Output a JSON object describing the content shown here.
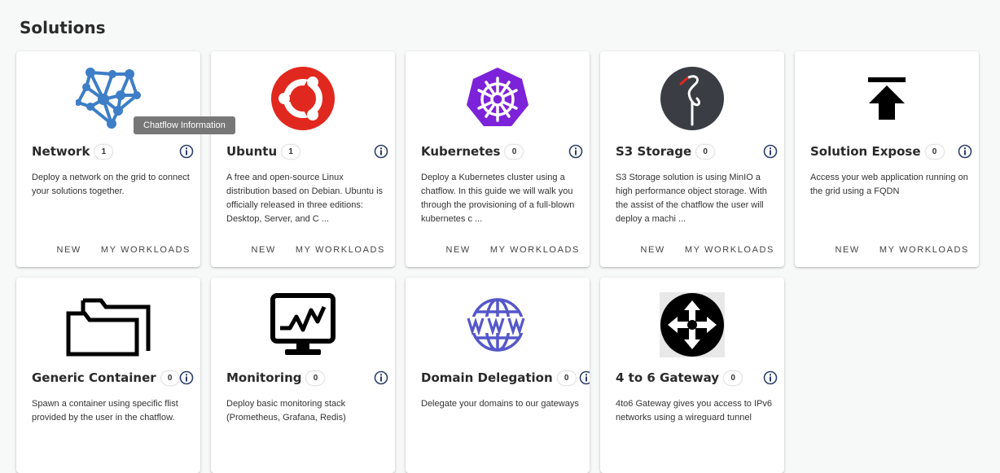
{
  "page": {
    "title": "Solutions"
  },
  "tooltip": {
    "text": "Chatflow Information"
  },
  "actions": {
    "new_label": "NEW",
    "workloads_label": "MY WORKLOADS"
  },
  "colors": {
    "info_icon": "#2c3e6b",
    "ubuntu": "#e1281e",
    "kubernetes": "#7c22d8",
    "s3": "#3a3d44",
    "network": "#3d7ec6",
    "www": "#5557c9"
  },
  "solutions": [
    {
      "name": "Network",
      "count": "1",
      "icon": "network-graph-icon",
      "description": "Deploy a network on the grid to connect your solutions together."
    },
    {
      "name": "Ubuntu",
      "count": "1",
      "icon": "ubuntu-logo-icon",
      "description": "A free and open-source Linux distribution based on Debian. Ubuntu is officially released in three editions: Desktop, Server, and C ..."
    },
    {
      "name": "Kubernetes",
      "count": "0",
      "icon": "kubernetes-helm-icon",
      "description": "Deploy a Kubernetes cluster using a chatflow. In this guide we will walk you through the provisioning of a full-blown kubernetes c ..."
    },
    {
      "name": "S3 Storage",
      "count": "0",
      "icon": "minio-flamingo-icon",
      "description": "S3 Storage solution is using MinIO a high performance object storage. With the assist of the chatflow the user will deploy a machi ..."
    },
    {
      "name": "Solution Expose",
      "count": "0",
      "icon": "upload-arrow-icon",
      "description": "Access your web application running on the grid using a FQDN"
    },
    {
      "name": "Generic Container",
      "count": "0",
      "icon": "folders-icon",
      "description": "Spawn a container using specific flist provided by the user in the chatflow."
    },
    {
      "name": "Monitoring",
      "count": "0",
      "icon": "monitor-chart-icon",
      "description": "Deploy basic monitoring stack (Prometheus, Grafana, Redis)"
    },
    {
      "name": "Domain Delegation",
      "count": "0",
      "icon": "www-globe-icon",
      "description": "Delegate your domains to our gateways"
    },
    {
      "name": "4 to 6 Gateway",
      "count": "0",
      "icon": "gateway-arrows-icon",
      "description": "4to6 Gateway gives you access to IPv6 networks using a wireguard tunnel"
    }
  ]
}
